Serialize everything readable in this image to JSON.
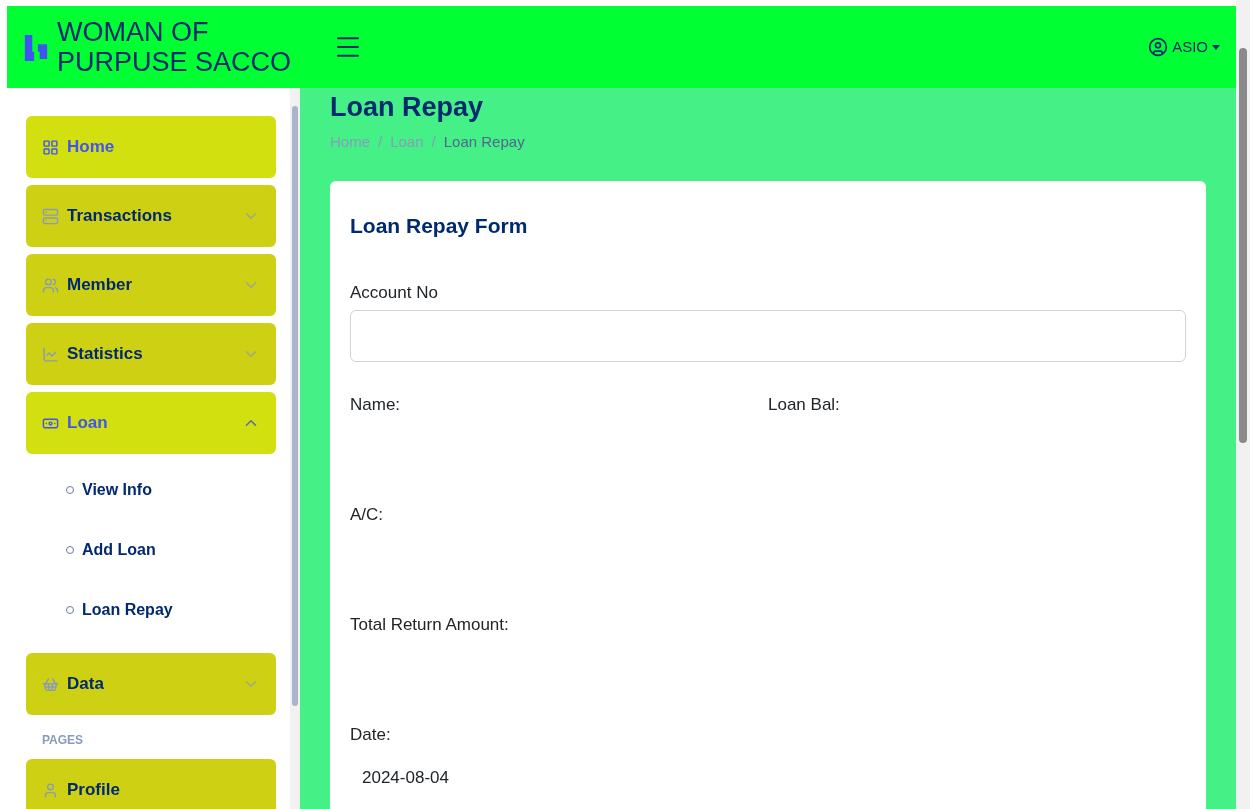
{
  "brand": {
    "line_1": "WOMAN OF",
    "line_2": "PURPUSE SACCO"
  },
  "user": {
    "name": "ASIO"
  },
  "sidebar": {
    "items": [
      {
        "label": "Home",
        "kind": "link",
        "selected": true
      },
      {
        "label": "Transactions",
        "kind": "dropdown",
        "selected": false,
        "expanded": false
      },
      {
        "label": "Member",
        "kind": "dropdown",
        "selected": false,
        "expanded": false
      },
      {
        "label": "Statistics",
        "kind": "dropdown",
        "selected": false,
        "expanded": false
      },
      {
        "label": "Loan",
        "kind": "dropdown",
        "selected": true,
        "expanded": true,
        "children": [
          {
            "label": "View Info"
          },
          {
            "label": "Add Loan"
          },
          {
            "label": "Loan Repay"
          }
        ]
      },
      {
        "label": "Data",
        "kind": "dropdown",
        "selected": false,
        "expanded": false
      }
    ],
    "section_heading": "PAGES",
    "pages": [
      {
        "label": "Profile",
        "selected": false
      }
    ]
  },
  "page": {
    "title": "Loan Repay",
    "breadcrumb": [
      {
        "label": "Home",
        "current": false
      },
      {
        "separator": "/"
      },
      {
        "label": "Loan",
        "current": false
      },
      {
        "separator": "/"
      },
      {
        "label": "Loan Repay",
        "current": true
      }
    ]
  },
  "form": {
    "title": "Loan Repay Form",
    "account_label": "Account No",
    "name_label": "Name:",
    "loan_bal_label": "Loan Bal:",
    "ac_label": "A/C:",
    "total_label": "Total Return Amount:",
    "date_label": "Date:",
    "date_value": "2024-08-04"
  }
}
